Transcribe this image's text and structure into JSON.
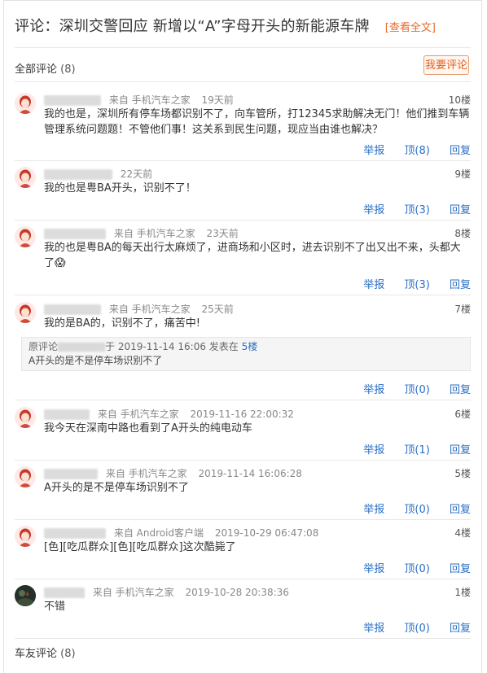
{
  "header": {
    "title": "评论：深圳交警回应 新增以“A”字母开头的新能源车牌",
    "fulltext": "[查看全文]"
  },
  "all_comments": {
    "label": "全部评论",
    "count": "(8)"
  },
  "write_button": "我要评论",
  "actions": {
    "report": "举报",
    "reply": "回复"
  },
  "comments": [
    {
      "source": "来自  手机汽车之家",
      "time": "19天前",
      "floor": "10楼",
      "text": "我的也是，深圳所有停车场都识别不了，向车管所，打12345求助解决无门！他们推到车辆管理系统问题题！不管他们事！这关系到民生问题，现应当由谁也解决？",
      "likes": "顶(8)"
    },
    {
      "source": "",
      "time": "22天前",
      "floor": "9楼",
      "text": "我的也是粤BA开头，识别不了！",
      "likes": "顶(3)"
    },
    {
      "source": "来自  手机汽车之家",
      "time": "23天前",
      "floor": "8楼",
      "text": "我的也是粤BA的每天出行太麻烦了，进商场和小区时，进去识别不了出又出不来，头都大了😱",
      "likes": "顶(3)"
    },
    {
      "source": "来自  手机汽车之家",
      "time": "25天前",
      "floor": "7楼",
      "text": "我的是BA的，识别不了，痛苦中!",
      "likes": "顶(0)"
    },
    {
      "source": "来自  手机汽车之家",
      "time": "2019-11-16 22:00:32",
      "floor": "6楼",
      "text": "我今天在深南中路也看到了A开头的纯电动车",
      "likes": "顶(1)"
    },
    {
      "source": "来自  手机汽车之家",
      "time": "2019-11-14 16:06:28",
      "floor": "5楼",
      "text": "A开头的是不是停车场识别不了",
      "likes": "顶(0)"
    },
    {
      "source": "来自  Android客户端",
      "time": "2019-10-29 06:47:08",
      "floor": "4楼",
      "text": "[色][吃瓜群众][色][吃瓜群众]这次酷毙了",
      "likes": "顶(0)"
    },
    {
      "source": "来自  手机汽车之家",
      "time": "2019-10-28 20:38:36",
      "floor": "1楼",
      "text": "不错",
      "likes": "顶(0)"
    }
  ],
  "quote": {
    "prefix": "原评论",
    "mid": "于 2019-11-14 16:06 发表在",
    "floor": "5楼",
    "text": "A开头的是不是停车场识别不了"
  },
  "friends_comments": {
    "label": "车友评论",
    "count": "(8)"
  },
  "colors": {
    "accent": "#e2601f",
    "link": "#2b6fc4",
    "avatar_bg": "#fde9e6"
  }
}
